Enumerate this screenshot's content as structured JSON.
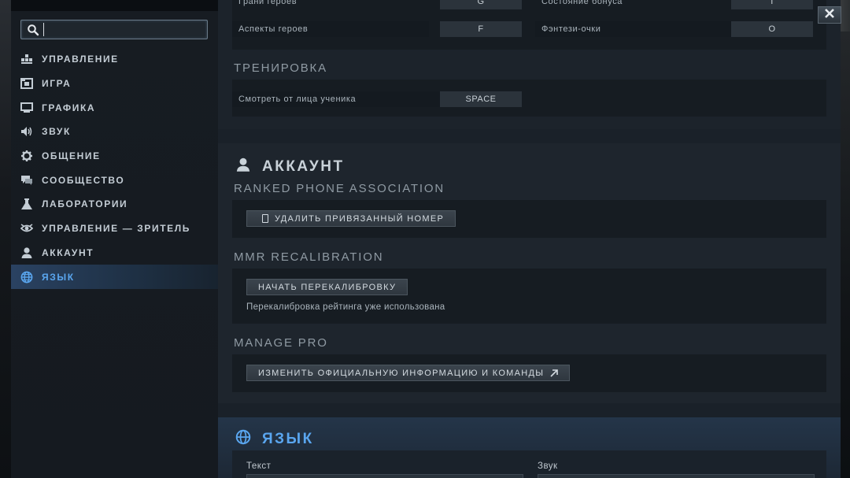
{
  "search": {
    "value": "",
    "placeholder": ""
  },
  "sidebar": {
    "items": [
      {
        "label": "УПРАВЛЕНИЕ",
        "icon": "controls-icon"
      },
      {
        "label": "ИГРА",
        "icon": "game-icon"
      },
      {
        "label": "ГРАФИКА",
        "icon": "monitor-icon"
      },
      {
        "label": "ЗВУК",
        "icon": "speaker-icon"
      },
      {
        "label": "ОБЩЕНИЕ",
        "icon": "gear-icon"
      },
      {
        "label": "СООБЩЕСТВО",
        "icon": "chat-icon"
      },
      {
        "label": "ЛАБОРАТОРИИ",
        "icon": "flask-icon"
      },
      {
        "label": "УПРАВЛЕНИЕ — ЗРИТЕЛЬ",
        "icon": "eye-icon"
      },
      {
        "label": "АККАУНТ",
        "icon": "user-icon"
      },
      {
        "label": "ЯЗЫК",
        "icon": "globe-icon"
      }
    ],
    "active_index": 9
  },
  "hotkeys": {
    "cut_row": {
      "left_name": "Грани героев",
      "left_key": "G",
      "right_name": "Состояние бонуса",
      "right_key": "I"
    },
    "row": {
      "left_name": "Аспекты героев",
      "left_key": "F",
      "right_name": "Фэнтези-очки",
      "right_key": "O"
    }
  },
  "training": {
    "heading": "ТРЕНИРОВКА",
    "row": {
      "name": "Смотреть от лица ученика",
      "key": "SPACE"
    }
  },
  "account": {
    "title": "АККАУНТ",
    "phone": {
      "heading": "RANKED PHONE ASSOCIATION",
      "button": "УДАЛИТЬ ПРИВЯЗАННЫЙ НОМЕР"
    },
    "mmr": {
      "heading": "MMR RECALIBRATION",
      "button": "НАЧАТЬ ПЕРЕКАЛИБРОВКУ",
      "note": "Перекалибровка рейтинга уже использована"
    },
    "pro": {
      "heading": "MANAGE PRO",
      "button": "ИЗМЕНИТЬ ОФИЦИАЛЬНУЮ ИНФОРМАЦИЮ И КОМАНДЫ"
    }
  },
  "language": {
    "title": "ЯЗЫК",
    "text_label": "Текст",
    "sound_label": "Звук"
  },
  "colors": {
    "accent": "#5aa6ef",
    "active_bg": "#2a4262"
  }
}
